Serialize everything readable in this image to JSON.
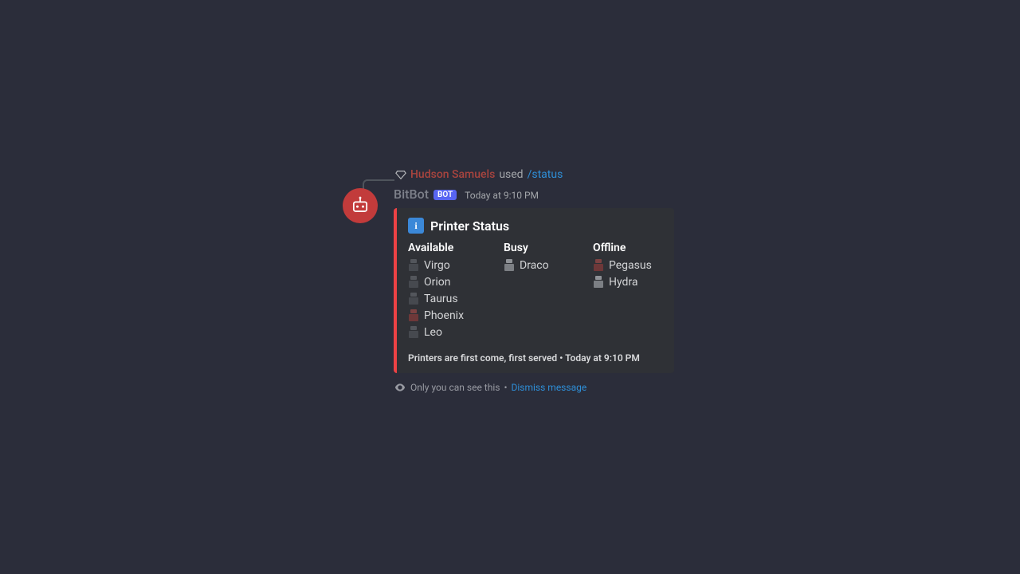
{
  "command_ref": {
    "invoker": "Hudson Samuels",
    "used_word": "used",
    "command": "/status"
  },
  "header": {
    "bot_name": "BitBot",
    "bot_badge": "BOT",
    "timestamp": "Today at 9:10 PM"
  },
  "embed": {
    "info_glyph": "i",
    "title": "Printer Status",
    "fields": {
      "available": {
        "name": "Available",
        "items": [
          "Virgo",
          "Orion",
          "Taurus",
          "Phoenix",
          "Leo"
        ]
      },
      "busy": {
        "name": "Busy",
        "items": [
          "Draco"
        ]
      },
      "offline": {
        "name": "Offline",
        "items": [
          "Pegasus",
          "Hydra"
        ]
      }
    },
    "footer": "Printers are first come, first served • Today at 9:10 PM"
  },
  "ephemeral": {
    "text": "Only you can see this",
    "sep": "•",
    "dismiss": "Dismiss message"
  },
  "colors": {
    "accent": "#ed4245",
    "link": "#2e8fd8",
    "badge": "#5865f2"
  }
}
